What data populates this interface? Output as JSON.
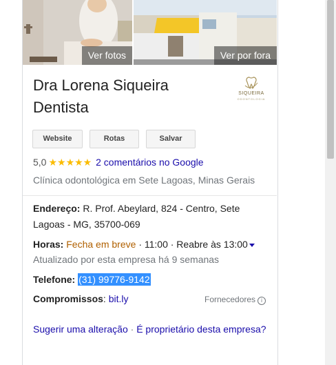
{
  "photos": {
    "left_label": "Ver fotos",
    "right_label": "Ver por fora"
  },
  "business": {
    "name_line1": "Dra Lorena Siqueira",
    "name_line2": "Dentista",
    "logo_text": "SIQUEIRA",
    "logo_subtext": "ODONTOLOGIA"
  },
  "actions": {
    "website": "Website",
    "routes": "Rotas",
    "save": "Salvar"
  },
  "rating": {
    "value": "5,0",
    "stars": "★★★★★",
    "reviews_link": "2 comentários no Google"
  },
  "category": "Clínica odontológica em Sete Lagoas, Minas Gerais",
  "address": {
    "label": "Endereço:",
    "line1": "R. Prof. Abeylard, 824 - Centro, Sete",
    "line2": "Lagoas - MG, 35700-069"
  },
  "hours": {
    "label": "Horas:",
    "status": "Fecha em breve",
    "text": "· 11:00 · Reabre às 13:00",
    "updated": "Atualizado por esta empresa há 9 semanas"
  },
  "phone": {
    "label": "Telefone:",
    "number": "(31) 99776-9142"
  },
  "appointments": {
    "label": "Compromissos",
    "link": "bit.ly",
    "providers": "Fornecedores"
  },
  "footer": {
    "suggest": "Sugerir uma alteração",
    "owner": "É proprietário desta empresa?"
  },
  "colors": {
    "link": "#1a0dab",
    "star": "#fbbc04",
    "status_orange": "#b06000",
    "phone_highlight": "#3390ff"
  }
}
